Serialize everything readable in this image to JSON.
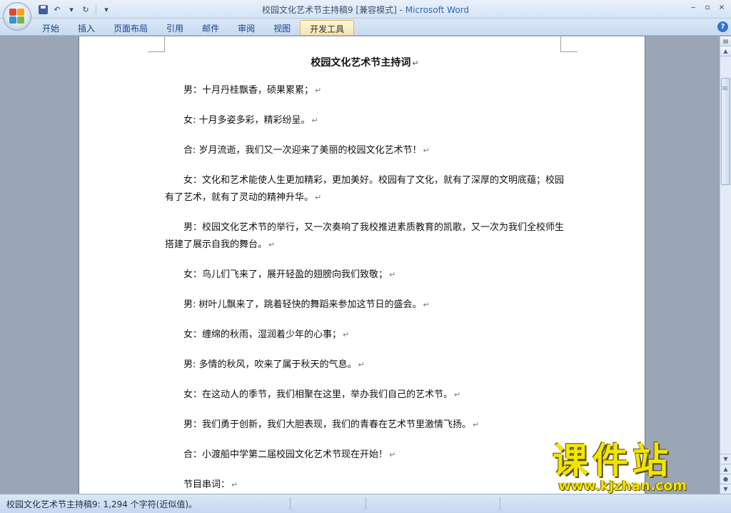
{
  "window": {
    "title": "校园文化艺术节主持稿9 [兼容模式]",
    "title_sep": " - ",
    "app_name": "Microsoft Word",
    "controls": [
      "‒",
      "▫",
      "×"
    ]
  },
  "qat": {
    "undo_glyph": "↶",
    "redo_glyph": "↻",
    "more_glyph": "▾"
  },
  "ribbon": {
    "tabs": [
      "开始",
      "插入",
      "页面布局",
      "引用",
      "邮件",
      "审阅",
      "视图",
      "开发工具"
    ],
    "active_tab": "开发工具",
    "help_glyph": "?"
  },
  "document": {
    "title": "校园文化艺术节主持词",
    "paragraphs": [
      "男：十月丹桂飘香，硕果累累；",
      "女: 十月多姿多彩，精彩纷呈。",
      "合: 岁月流逝，我们又一次迎来了美丽的校园文化艺术节！",
      "女：文化和艺术能使人生更加精彩，更加美好。校园有了文化，就有了深厚的文明底蕴；校园有了艺术，就有了灵动的精神升华。",
      "男：校园文化艺术节的举行，又一次奏响了我校推进素质教育的凯歌，又一次为我们全校师生搭建了展示自我的舞台。",
      "女：鸟儿们飞来了，展开轻盈的翅膀向我们致敬；",
      "男: 树叶儿飘来了，跳着轻快的舞蹈来参加这节日的盛会。",
      "女：缠绵的秋雨，湿润着少年的心事；",
      "男: 多情的秋风，吹来了属于秋天的气息。",
      "女：在这动人的季节，我们相聚在这里，举办我们自己的艺术节。",
      "男：我们勇于创新，我们大胆表现，我们的青春在艺术节里激情飞扬。",
      "合：小渡船中学第二届校园文化艺术节现在开始！",
      "节目串词："
    ],
    "para_mark": "↵"
  },
  "statusbar": {
    "text": "校园文化艺术节主持稿9: 1,294 个字符(近似值)。"
  },
  "watermark": {
    "text": "课件站",
    "url": "www.kjzhan.com"
  },
  "colors": {
    "accent": "#3467b8",
    "ribbon": "#c9dbf1",
    "workspace": "#9aa5b6",
    "watermark": "#f2e600"
  }
}
